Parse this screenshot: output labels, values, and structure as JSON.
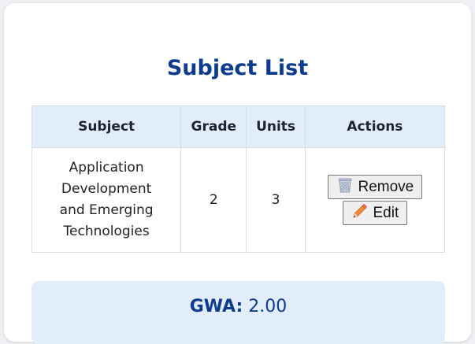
{
  "title": "Subject List",
  "table": {
    "headers": {
      "subject": "Subject",
      "grade": "Grade",
      "units": "Units",
      "actions": "Actions"
    },
    "rows": [
      {
        "subject": "Application Development and Emerging Technologies",
        "grade": "2",
        "units": "3",
        "remove_label": "Remove",
        "edit_label": "Edit"
      }
    ]
  },
  "gwa": {
    "label": "GWA:",
    "value": "2.00"
  },
  "colors": {
    "accent": "#0f3b8f",
    "header_bg": "#e2edfb"
  },
  "icons": {
    "remove": "wastebasket-icon",
    "edit": "pencil-icon"
  }
}
